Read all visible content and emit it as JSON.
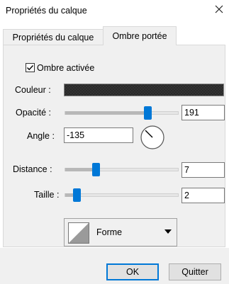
{
  "window": {
    "title": "Propriétés du calque",
    "close_icon": "close-icon"
  },
  "tabs": [
    {
      "label": "Propriétés du calque",
      "active": false
    },
    {
      "label": "Ombre portée",
      "active": true
    }
  ],
  "shadow": {
    "enabled_label": "Ombre activée",
    "enabled": true,
    "color_label": "Couleur :",
    "color": "#333333",
    "opacity_label": "Opacité :",
    "opacity_value": "191",
    "opacity_max": 255,
    "angle_label": "Angle :",
    "angle_value": "-135",
    "distance_label": "Distance :",
    "distance_value": "7",
    "distance_fraction": 0.26,
    "size_label": "Taille :",
    "size_value": "2",
    "size_fraction": 0.08
  },
  "shape": {
    "label": "Forme",
    "icon": "shape-preview-icon"
  },
  "buttons": {
    "ok": "OK",
    "quit": "Quitter"
  },
  "colors": {
    "accent": "#0078d7",
    "panel": "#f0f0f0"
  }
}
